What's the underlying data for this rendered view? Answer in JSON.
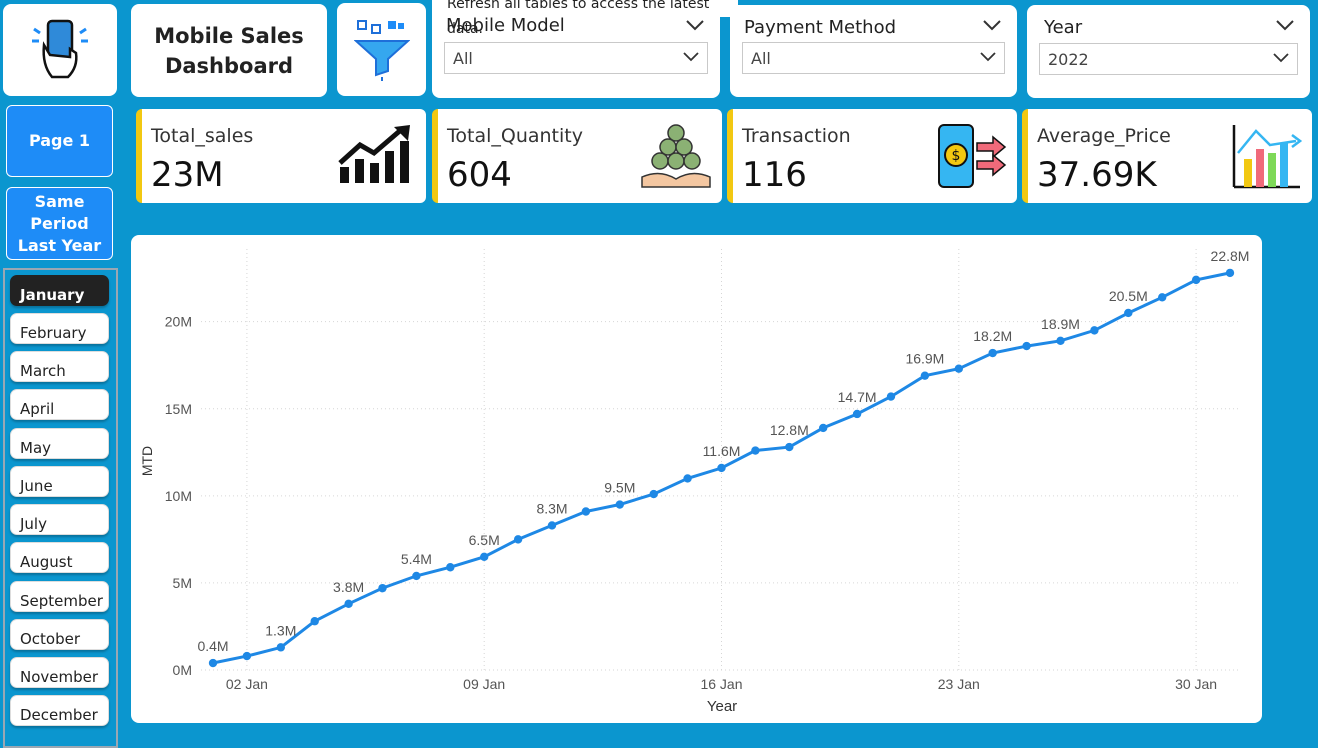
{
  "header": {
    "title_line1": "Mobile Sales",
    "title_line2": "Dashboard"
  },
  "tooltip": "Refresh all tables to access the latest data.",
  "nav": {
    "page1": "Page 1",
    "same_period_line1": "Same Period",
    "same_period_line2": "Last Year"
  },
  "slicers": {
    "model": {
      "title": "Mobile Model",
      "value": "All"
    },
    "payment": {
      "title": "Payment Method",
      "value": "All"
    },
    "year": {
      "title": "Year",
      "value": "2022"
    }
  },
  "kpis": {
    "sales": {
      "label": "Total_sales",
      "value": "23M"
    },
    "quantity": {
      "label": "Total_Quantity",
      "value": "604"
    },
    "transaction": {
      "label": "Transaction",
      "value": "116"
    },
    "price": {
      "label": "Average_Price",
      "value": "37.69K"
    }
  },
  "months": [
    "January",
    "February",
    "March",
    "April",
    "May",
    "June",
    "July",
    "August",
    "September",
    "October",
    "November",
    "December"
  ],
  "selected_month": "January",
  "colors": {
    "background": "#0b96cf",
    "line": "#1e88e5",
    "accent": "#f2c811",
    "button": "#1e8cf7"
  },
  "chart_data": {
    "type": "line",
    "xlabel": "Year",
    "ylabel": "MTD",
    "ylim": [
      0,
      24
    ],
    "yticks": [
      0,
      5,
      10,
      15,
      20
    ],
    "ytick_labels": [
      "0M",
      "5M",
      "10M",
      "15M",
      "20M"
    ],
    "xtick_days": [
      2,
      9,
      16,
      23,
      30
    ],
    "xtick_labels": [
      "02 Jan",
      "09 Jan",
      "16 Jan",
      "23 Jan",
      "30 Jan"
    ],
    "grid": true,
    "series": [
      {
        "x": [
          1,
          2,
          3,
          4,
          5,
          6,
          7,
          8,
          9,
          10,
          11,
          12,
          13,
          14,
          15,
          16,
          17,
          18,
          19,
          20,
          21,
          22,
          23,
          24,
          25,
          26,
          27,
          28,
          29,
          30,
          31
        ],
        "values": [
          0.4,
          0.8,
          1.3,
          2.8,
          3.8,
          4.7,
          5.4,
          5.9,
          6.5,
          7.5,
          8.3,
          9.1,
          9.5,
          10.1,
          11.0,
          11.6,
          12.6,
          12.8,
          13.9,
          14.7,
          15.7,
          16.9,
          17.3,
          18.2,
          18.6,
          18.9,
          19.5,
          20.5,
          21.4,
          22.4,
          22.8
        ],
        "labels": [
          "0.4M",
          "",
          "1.3M",
          "",
          "3.8M",
          "",
          "5.4M",
          "",
          "6.5M",
          "",
          "8.3M",
          "",
          "9.5M",
          "",
          "",
          "11.6M",
          "",
          "12.8M",
          "",
          "14.7M",
          "",
          "16.9M",
          "",
          "18.2M",
          "",
          "18.9M",
          "",
          "20.5M",
          "",
          "",
          "22.8M"
        ]
      }
    ]
  }
}
